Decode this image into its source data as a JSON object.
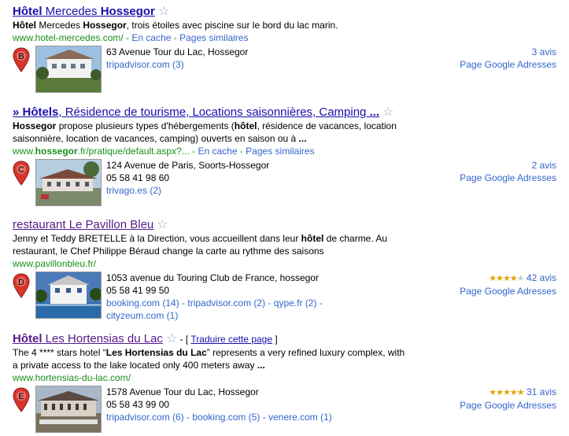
{
  "results": [
    {
      "title_bold1": "Hôtel",
      "title_mid": " Mercedes ",
      "title_bold2": "Hossegor",
      "snippet_parts": [
        "Hôtel",
        " Mercedes ",
        "Hossegor",
        ", trois étoiles avec piscine sur le bord du lac marin."
      ],
      "url": "www.hotel-mercedes.com/",
      "cache": "En cache",
      "similar": "Pages similaires",
      "pin_letter": "B",
      "address": "63 Avenue Tour du Lac, Hossegor",
      "phone": "",
      "sources": [
        "tripadvisor.com (3)"
      ],
      "reviews": "3 avis",
      "places": "Page Google Adresses"
    },
    {
      "title_prefix": "» ",
      "title_bold1": "Hôtels",
      "title_rest": ", Résidence de tourisme, Locations saisonnières, Camping ",
      "title_ellipsis": "...",
      "snippet_line1_parts": [
        "Hossegor",
        " propose plusieurs types d'hébergements (",
        "hôtel",
        ", résidence de vacances, location"
      ],
      "snippet_line2_parts": [
        "saisonnière, location de vacances, camping) ouverts en saison ou à ",
        "..."
      ],
      "url_pre": "www.",
      "url_bold": "hossegor",
      "url_post": ".fr/pratique/default.aspx?...",
      "cache": "En cache",
      "similar": "Pages similaires",
      "pin_letter": "C",
      "address": "124 Avenue de Paris, Soorts-Hossegor",
      "phone": "05 58 41 98 60",
      "sources": [
        "trivago.es (2)"
      ],
      "reviews": "2 avis",
      "places": "Page Google Adresses"
    },
    {
      "title": "restaurant Le Pavillon Bleu",
      "snippet_line1_parts": [
        "Jenny et Teddy BRETELLE à la Direction, vous accueillent dans leur ",
        "hôtel",
        " de charme. Au"
      ],
      "snippet_line2": "restaurant, le Chef Philippe Béraud change la carte au rythme des saisons",
      "url": "www.pavillonbleu.fr/",
      "pin_letter": "D",
      "address": "1053 avenue du Touring Club de France, hossegor",
      "phone": "05 58 41 99 50",
      "sources": [
        "booking.com (14)",
        "tripadvisor.com (2)",
        "qype.fr (2)",
        "cityzeum.com (1)"
      ],
      "rating": 4,
      "reviews": "42 avis",
      "places": "Page Google Adresses"
    },
    {
      "title_bold1": "Hôtel",
      "title_rest": " Les Hortensias du Lac",
      "translate_open": " - [ ",
      "translate": "Traduire cette page",
      "translate_close": " ]",
      "snippet_line1_parts": [
        "The 4 **** stars hotel “",
        "Les Hortensias du Lac",
        "” represents a very refined luxury complex, with"
      ],
      "snippet_line2_parts": [
        "a private access to the lake located only 400 meters away ",
        "..."
      ],
      "url": "www.hortensias-du-lac.com/",
      "pin_letter": "E",
      "address": "1578 Avenue Tour du Lac, Hossegor",
      "phone": "05 58 43 99 00",
      "sources": [
        "tripadvisor.com (6)",
        "booking.com (5)",
        "venere.com (1)"
      ],
      "rating": 5,
      "reviews": "31 avis",
      "places": "Page Google Adresses"
    }
  ],
  "colors": {
    "link": "#1a0dab",
    "visited": "#551a8b",
    "url_green": "#1a8f1a",
    "secondary_link": "#3366cc",
    "pin_red": "#d9342b",
    "star_gold": "#e8a200"
  },
  "icons": [
    "star-outline-icon",
    "map-pin-icon",
    "rating-star-icon"
  ]
}
